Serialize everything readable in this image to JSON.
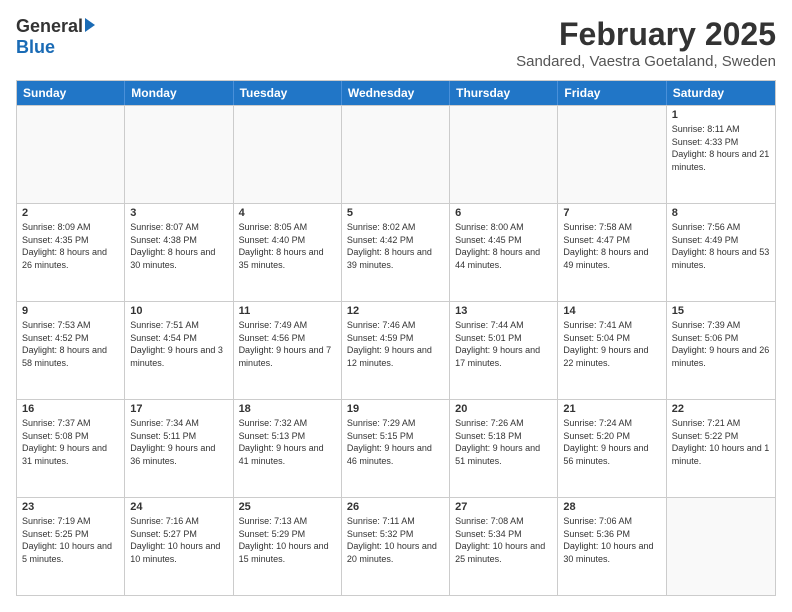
{
  "logo": {
    "general": "General",
    "blue": "Blue"
  },
  "title": "February 2025",
  "location": "Sandared, Vaestra Goetaland, Sweden",
  "days": [
    "Sunday",
    "Monday",
    "Tuesday",
    "Wednesday",
    "Thursday",
    "Friday",
    "Saturday"
  ],
  "rows": [
    [
      {
        "day": "",
        "text": ""
      },
      {
        "day": "",
        "text": ""
      },
      {
        "day": "",
        "text": ""
      },
      {
        "day": "",
        "text": ""
      },
      {
        "day": "",
        "text": ""
      },
      {
        "day": "",
        "text": ""
      },
      {
        "day": "1",
        "text": "Sunrise: 8:11 AM\nSunset: 4:33 PM\nDaylight: 8 hours and 21 minutes."
      }
    ],
    [
      {
        "day": "2",
        "text": "Sunrise: 8:09 AM\nSunset: 4:35 PM\nDaylight: 8 hours and 26 minutes."
      },
      {
        "day": "3",
        "text": "Sunrise: 8:07 AM\nSunset: 4:38 PM\nDaylight: 8 hours and 30 minutes."
      },
      {
        "day": "4",
        "text": "Sunrise: 8:05 AM\nSunset: 4:40 PM\nDaylight: 8 hours and 35 minutes."
      },
      {
        "day": "5",
        "text": "Sunrise: 8:02 AM\nSunset: 4:42 PM\nDaylight: 8 hours and 39 minutes."
      },
      {
        "day": "6",
        "text": "Sunrise: 8:00 AM\nSunset: 4:45 PM\nDaylight: 8 hours and 44 minutes."
      },
      {
        "day": "7",
        "text": "Sunrise: 7:58 AM\nSunset: 4:47 PM\nDaylight: 8 hours and 49 minutes."
      },
      {
        "day": "8",
        "text": "Sunrise: 7:56 AM\nSunset: 4:49 PM\nDaylight: 8 hours and 53 minutes."
      }
    ],
    [
      {
        "day": "9",
        "text": "Sunrise: 7:53 AM\nSunset: 4:52 PM\nDaylight: 8 hours and 58 minutes."
      },
      {
        "day": "10",
        "text": "Sunrise: 7:51 AM\nSunset: 4:54 PM\nDaylight: 9 hours and 3 minutes."
      },
      {
        "day": "11",
        "text": "Sunrise: 7:49 AM\nSunset: 4:56 PM\nDaylight: 9 hours and 7 minutes."
      },
      {
        "day": "12",
        "text": "Sunrise: 7:46 AM\nSunset: 4:59 PM\nDaylight: 9 hours and 12 minutes."
      },
      {
        "day": "13",
        "text": "Sunrise: 7:44 AM\nSunset: 5:01 PM\nDaylight: 9 hours and 17 minutes."
      },
      {
        "day": "14",
        "text": "Sunrise: 7:41 AM\nSunset: 5:04 PM\nDaylight: 9 hours and 22 minutes."
      },
      {
        "day": "15",
        "text": "Sunrise: 7:39 AM\nSunset: 5:06 PM\nDaylight: 9 hours and 26 minutes."
      }
    ],
    [
      {
        "day": "16",
        "text": "Sunrise: 7:37 AM\nSunset: 5:08 PM\nDaylight: 9 hours and 31 minutes."
      },
      {
        "day": "17",
        "text": "Sunrise: 7:34 AM\nSunset: 5:11 PM\nDaylight: 9 hours and 36 minutes."
      },
      {
        "day": "18",
        "text": "Sunrise: 7:32 AM\nSunset: 5:13 PM\nDaylight: 9 hours and 41 minutes."
      },
      {
        "day": "19",
        "text": "Sunrise: 7:29 AM\nSunset: 5:15 PM\nDaylight: 9 hours and 46 minutes."
      },
      {
        "day": "20",
        "text": "Sunrise: 7:26 AM\nSunset: 5:18 PM\nDaylight: 9 hours and 51 minutes."
      },
      {
        "day": "21",
        "text": "Sunrise: 7:24 AM\nSunset: 5:20 PM\nDaylight: 9 hours and 56 minutes."
      },
      {
        "day": "22",
        "text": "Sunrise: 7:21 AM\nSunset: 5:22 PM\nDaylight: 10 hours and 1 minute."
      }
    ],
    [
      {
        "day": "23",
        "text": "Sunrise: 7:19 AM\nSunset: 5:25 PM\nDaylight: 10 hours and 5 minutes."
      },
      {
        "day": "24",
        "text": "Sunrise: 7:16 AM\nSunset: 5:27 PM\nDaylight: 10 hours and 10 minutes."
      },
      {
        "day": "25",
        "text": "Sunrise: 7:13 AM\nSunset: 5:29 PM\nDaylight: 10 hours and 15 minutes."
      },
      {
        "day": "26",
        "text": "Sunrise: 7:11 AM\nSunset: 5:32 PM\nDaylight: 10 hours and 20 minutes."
      },
      {
        "day": "27",
        "text": "Sunrise: 7:08 AM\nSunset: 5:34 PM\nDaylight: 10 hours and 25 minutes."
      },
      {
        "day": "28",
        "text": "Sunrise: 7:06 AM\nSunset: 5:36 PM\nDaylight: 10 hours and 30 minutes."
      },
      {
        "day": "",
        "text": ""
      }
    ]
  ]
}
